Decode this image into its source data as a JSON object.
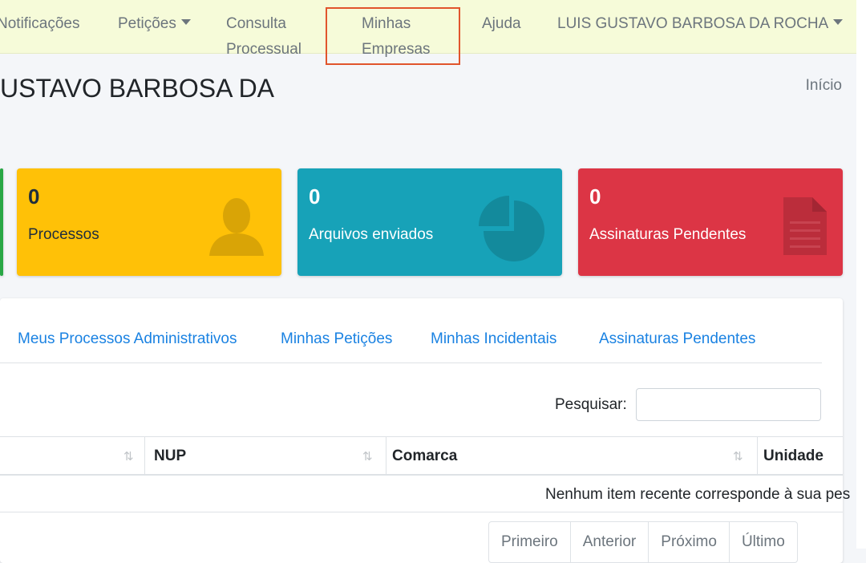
{
  "nav": {
    "items": [
      {
        "label": "Notificações"
      },
      {
        "label": "Petições"
      },
      {
        "label": "Consulta"
      },
      {
        "label": "Processual"
      },
      {
        "label": "Minhas"
      },
      {
        "label": "Empresas"
      },
      {
        "label": "Ajuda"
      },
      {
        "label": "LUIS GUSTAVO BARBOSA DA ROCHA"
      }
    ]
  },
  "header": {
    "title": "USTAVO BARBOSA DA",
    "breadcrumb": "Início"
  },
  "stats": [
    {
      "value": "0",
      "label": "Processos",
      "icon": "user-icon",
      "color": "#ffc107"
    },
    {
      "value": "0",
      "label": "Arquivos enviados",
      "icon": "pie-chart-icon",
      "color": "#17a2b8"
    },
    {
      "value": "0",
      "label": "Assinaturas Pendentes",
      "icon": "document-icon",
      "color": "#dc3545"
    }
  ],
  "tabs": [
    {
      "label": "Meus Processos Administrativos"
    },
    {
      "label": "Minhas Petições"
    },
    {
      "label": "Minhas Incidentais"
    },
    {
      "label": "Assinaturas Pendentes"
    }
  ],
  "table": {
    "search_label": "Pesquisar:",
    "search_value": "",
    "columns": [
      "NUP",
      "Comarca",
      "Unidade"
    ],
    "empty_message": "Nenhum item recente corresponde à sua pes"
  },
  "pagination": {
    "first": "Primeiro",
    "previous": "Anterior",
    "next": "Próximo",
    "last": "Último"
  }
}
